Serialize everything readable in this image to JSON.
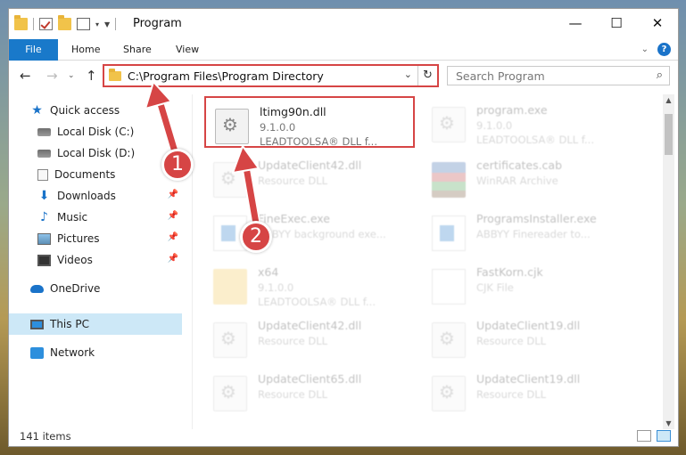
{
  "window": {
    "title": "Program",
    "controls": {
      "minimize": "—",
      "maximize": "☐",
      "close": "✕"
    }
  },
  "ribbon": {
    "tabs": [
      "File",
      "Home",
      "Share",
      "View"
    ],
    "help": "?"
  },
  "address": {
    "path": "C:\\Program Files\\Program Directory",
    "refresh": "↻"
  },
  "search": {
    "placeholder": "Search Program"
  },
  "nav": {
    "back": "←",
    "forward": "→",
    "up": "↑"
  },
  "sidebar": {
    "items": [
      {
        "label": "Quick access",
        "icon": "star-icon"
      },
      {
        "label": "Local Disk (C:)",
        "icon": "disk-icon"
      },
      {
        "label": "Local Disk (D:)",
        "icon": "disk-icon"
      },
      {
        "label": "Documents",
        "icon": "document-icon"
      },
      {
        "label": "Downloads",
        "icon": "download-icon"
      },
      {
        "label": "Music",
        "icon": "music-icon"
      },
      {
        "label": "Pictures",
        "icon": "pictures-icon"
      },
      {
        "label": "Videos",
        "icon": "video-icon"
      },
      {
        "label": "OneDrive",
        "icon": "cloud-icon"
      },
      {
        "label": "This PC",
        "icon": "computer-icon"
      },
      {
        "label": "Network",
        "icon": "network-icon"
      }
    ]
  },
  "files": [
    {
      "name": "ltimg90n.dll",
      "line1": "9.1.0.0",
      "line2": "LEADTOOLSA® DLL f...",
      "icon": "dll-icon"
    },
    {
      "name": "program.exe",
      "line1": "9.1.0.0",
      "line2": "LEADTOOLSA® DLL f...",
      "icon": "dll-icon"
    },
    {
      "name": "UpdateClient42.dll",
      "line1": "Resource DLL",
      "line2": "",
      "icon": "dll-icon"
    },
    {
      "name": "certificates.cab",
      "line1": "WinRAR Archive",
      "line2": "",
      "icon": "archive-icon"
    },
    {
      "name": "FineExec.exe",
      "line1": "ABBYY background exe...",
      "line2": "",
      "icon": "exe-icon"
    },
    {
      "name": "ProgramsInstaller.exe",
      "line1": "ABBYY Finereader to...",
      "line2": "",
      "icon": "exe-icon"
    },
    {
      "name": "x64",
      "line1": "9.1.0.0",
      "line2": "LEADTOOLSA® DLL f...",
      "icon": "folder-icon"
    },
    {
      "name": "FastKorn.cjk",
      "line1": "CJK File",
      "line2": "",
      "icon": "file-icon"
    },
    {
      "name": "UpdateClient42.dll",
      "line1": "Resource DLL",
      "line2": "",
      "icon": "dll-icon"
    },
    {
      "name": "UpdateClient19.dll",
      "line1": "Resource DLL",
      "line2": "",
      "icon": "dll-icon"
    },
    {
      "name": "UpdateClient65.dll",
      "line1": "Resource DLL",
      "line2": "",
      "icon": "dll-icon"
    },
    {
      "name": "UpdateClient19.dll",
      "line1": "Resource DLL",
      "line2": "",
      "icon": "dll-icon"
    }
  ],
  "status": {
    "count": "141 items"
  },
  "annotations": {
    "badge1": "1",
    "badge2": "2",
    "color": "#d64545"
  }
}
